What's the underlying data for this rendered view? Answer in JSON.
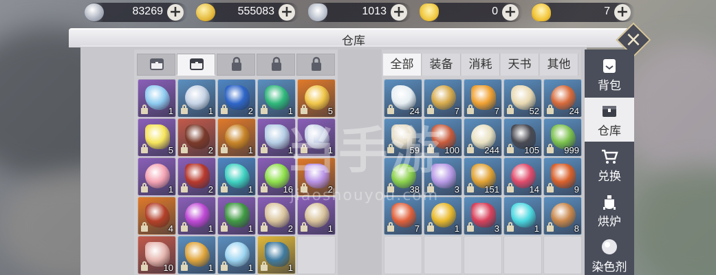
{
  "currencies": [
    {
      "name": "silver-coin-icon",
      "value": "83269",
      "color": "#c9ccd6"
    },
    {
      "name": "gold-coin-icon",
      "value": "555083",
      "color": "#e5b93c"
    },
    {
      "name": "silver-ingot-icon",
      "value": "1013",
      "color": "#cfd4df"
    },
    {
      "name": "gold-ingot-icon",
      "value": "0",
      "color": "#f0c840"
    },
    {
      "name": "gold-yuanbao-icon",
      "value": "7",
      "color": "#f3c63a"
    }
  ],
  "plus_label": "+",
  "title": "仓库",
  "close_label": "×",
  "right_tabs": [
    "全部",
    "装备",
    "消耗",
    "天书",
    "其他"
  ],
  "side_menu": [
    {
      "label": "背包",
      "icon": "backpack-icon"
    },
    {
      "label": "仓库",
      "icon": "warehouse-chest-icon"
    },
    {
      "label": "兑换",
      "icon": "shop-cart-icon"
    },
    {
      "label": "烘炉",
      "icon": "furnace-icon"
    },
    {
      "label": "染色剂",
      "icon": "dye-icon"
    }
  ],
  "left_items": [
    {
      "bg": "#8a5fb8",
      "art": "#8ecbf0",
      "count": "1",
      "icon": "crystal-shard-icon"
    },
    {
      "bg": "#5b8fbf",
      "art": "#c7d4e6",
      "count": "1",
      "icon": "silver-shard-icon"
    },
    {
      "bg": "#4f86c2",
      "art": "#2f66c9",
      "count": "2",
      "icon": "blue-gem-icon"
    },
    {
      "bg": "#5b8fbf",
      "art": "#2fb87a",
      "count": "1",
      "icon": "jade-icon"
    },
    {
      "bg": "#e07a2a",
      "art": "#f0c64a",
      "count": "5",
      "icon": "gold-box-icon"
    },
    {
      "bg": "#8a5fb8",
      "art": "#f5e45a",
      "count": "5",
      "icon": "star-crystal-icon"
    },
    {
      "bg": "#c25a4a",
      "art": "#7a3a2a",
      "count": "2",
      "icon": "round-shield-icon"
    },
    {
      "bg": "#e07a2a",
      "art": "#c8862a",
      "count": "1",
      "icon": "spear-icon"
    },
    {
      "bg": "#8a5fb8",
      "art": "#b6cfe6",
      "count": "1",
      "icon": "bow-icon"
    },
    {
      "bg": "#8a5fb8",
      "art": "#c9d3e8",
      "count": "1",
      "icon": "pants-icon"
    },
    {
      "bg": "#8a5fb8",
      "art": "#f4a3b3",
      "count": "1",
      "icon": "pig-icon"
    },
    {
      "bg": "#8a5fb8",
      "art": "#b8392c",
      "count": "2",
      "icon": "helmet-icon"
    },
    {
      "bg": "#4f86c2",
      "art": "#3fd1c0",
      "count": "1",
      "icon": "feather-icon"
    },
    {
      "bg": "#8a5fb8",
      "art": "#8ee04a",
      "count": "16",
      "icon": "green-scroll-icon"
    },
    {
      "bg": "#e07a2a",
      "art": "#b892e6",
      "count": "2",
      "icon": "purple-crystal-icon"
    },
    {
      "bg": "#e07a2a",
      "art": "#b3402a",
      "count": "4",
      "icon": "red-talisman-icon"
    },
    {
      "bg": "#8a5fb8",
      "art": "#c04ad6",
      "count": "1",
      "icon": "purple-orb-icon"
    },
    {
      "bg": "#8a5fb8",
      "art": "#3f9a42",
      "count": "1",
      "icon": "green-spider-icon"
    },
    {
      "bg": "#8a5fb8",
      "art": "#d8c39a",
      "count": "2",
      "icon": "scroll-icon"
    },
    {
      "bg": "#8a5fb8",
      "art": "#d8c39a",
      "count": "1",
      "icon": "scroll-icon"
    },
    {
      "bg": "#c25a4a",
      "art": "#e6b7b0",
      "count": "10",
      "icon": "card-icon"
    },
    {
      "bg": "#5b8fbf",
      "art": "#e0a43a",
      "count": "1",
      "icon": "padlock-icon"
    },
    {
      "bg": "#5b8fbf",
      "art": "#9fd6f2",
      "count": "1",
      "icon": "potion-icon"
    },
    {
      "bg": "#e0b83a",
      "art": "#3f7aa0",
      "count": "1",
      "icon": "treasure-chest-icon"
    }
  ],
  "right_items": [
    {
      "bg": "#5b8fbf",
      "art": "#e6eef2",
      "count": "24",
      "icon": "rice-bowl-icon"
    },
    {
      "bg": "#5b8fbf",
      "art": "#d6a94a",
      "count": "7",
      "icon": "herb-icon"
    },
    {
      "bg": "#5b8fbf",
      "art": "#f0a030",
      "count": "7",
      "icon": "fire-orb-icon"
    },
    {
      "bg": "#5b8fbf",
      "art": "#e8d8b0",
      "count": "52",
      "icon": "dumplings-icon"
    },
    {
      "bg": "#5b8fbf",
      "art": "#d86a3a",
      "count": "24",
      "icon": "dish-icon"
    },
    {
      "bg": "#5b8fbf",
      "art": "#e6dcc6",
      "count": "59",
      "icon": "soup-bowl-icon"
    },
    {
      "bg": "#5b8fbf",
      "art": "#c85a3a",
      "count": "100",
      "icon": "meat-dish-icon"
    },
    {
      "bg": "#5b8fbf",
      "art": "#e8e0c0",
      "count": "244",
      "icon": "tea-bowl-icon"
    },
    {
      "bg": "#5b8fbf",
      "art": "#4a4a52",
      "count": "105",
      "icon": "pickaxe-icon"
    },
    {
      "bg": "#5b8fbf",
      "art": "#7ac04a",
      "count": "999",
      "icon": "pea-pod-icon"
    },
    {
      "bg": "#5b8fbf",
      "art": "#8ad04a",
      "count": "38",
      "icon": "green-pod-icon"
    },
    {
      "bg": "#5b8fbf",
      "art": "#b89ae6",
      "count": "3",
      "icon": "amethyst-icon"
    },
    {
      "bg": "#5b8fbf",
      "art": "#e0a030",
      "count": "151",
      "icon": "amber-icon"
    },
    {
      "bg": "#5b8fbf",
      "art": "#e04a6a",
      "count": "14",
      "icon": "ruby-icon"
    },
    {
      "bg": "#5b8fbf",
      "art": "#d8602a",
      "count": "9",
      "icon": "garnet-icon"
    },
    {
      "bg": "#5b8fbf",
      "art": "#e0603a",
      "count": "7",
      "icon": "red-ore-icon"
    },
    {
      "bg": "#5b8fbf",
      "art": "#e8b82a",
      "count": "1",
      "icon": "topaz-icon"
    },
    {
      "bg": "#5b8fbf",
      "art": "#d8405a",
      "count": "3",
      "icon": "red-crystal-icon"
    },
    {
      "bg": "#5b8fbf",
      "art": "#4ad8e0",
      "count": "1",
      "icon": "aquamarine-icon"
    },
    {
      "bg": "#5b8fbf",
      "art": "#c8864a",
      "count": "8",
      "icon": "scroll-bundle-icon"
    }
  ],
  "watermark": "当手游",
  "watermark_url": "jiaoshouyou.com"
}
